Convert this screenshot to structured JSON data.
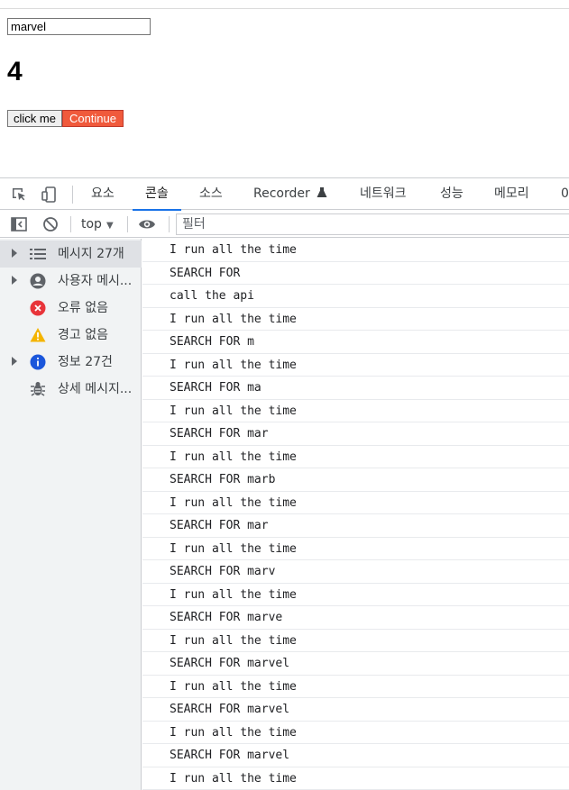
{
  "page": {
    "search_value": "marvel",
    "count": "4",
    "click_button": "click me",
    "continue_button": "Continue",
    "continue_color": "#f05a3c"
  },
  "devtools": {
    "tabs": [
      "요소",
      "콘솔",
      "소스",
      "Recorder",
      "네트워크",
      "성능",
      "메모리",
      "0"
    ],
    "active_tab": "콘솔",
    "context": "top",
    "filter_placeholder": "필터",
    "sidebar": [
      {
        "label": "메시지 27개",
        "icon": "list-icon",
        "expandable": true,
        "selected": true
      },
      {
        "label": "사용자 메시...",
        "icon": "user-icon",
        "expandable": true
      },
      {
        "label": "오류 없음",
        "icon": "error-icon",
        "expandable": false
      },
      {
        "label": "경고 없음",
        "icon": "warning-icon",
        "expandable": false
      },
      {
        "label": "정보 27건",
        "icon": "info-icon",
        "expandable": true
      },
      {
        "label": "상세 메시지...",
        "icon": "bug-icon",
        "expandable": false
      }
    ],
    "accent_color": "#1a73e8",
    "logs": [
      "I run all the time",
      "SEARCH FOR",
      "call the api",
      "I run all the time",
      "SEARCH FOR m",
      "I run all the time",
      "SEARCH FOR ma",
      "I run all the time",
      "SEARCH FOR mar",
      "I run all the time",
      "SEARCH FOR marb",
      "I run all the time",
      "SEARCH FOR mar",
      "I run all the time",
      "SEARCH FOR marv",
      "I run all the time",
      "SEARCH FOR marve",
      "I run all the time",
      "SEARCH FOR marvel",
      "I run all the time",
      "SEARCH FOR marvel",
      "I run all the time",
      "SEARCH FOR marvel",
      "I run all the time"
    ]
  }
}
